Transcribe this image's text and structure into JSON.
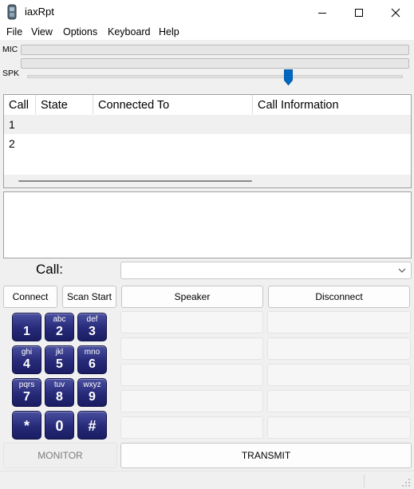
{
  "window": {
    "title": "iaxRpt",
    "controls": {
      "minimize": "minimize",
      "maximize": "maximize",
      "close": "close"
    }
  },
  "menu": [
    "File",
    "View",
    "Options",
    "Keyboard",
    "Help"
  ],
  "audio": {
    "mic_label": "MIC",
    "spk_label": "SPK",
    "mic_level": 0,
    "spk_level": 0,
    "spk_volume": 0.7
  },
  "calls_table": {
    "columns": [
      "Call",
      "State",
      "Connected To",
      "Call Information"
    ],
    "rows": [
      {
        "call": "1",
        "state": "",
        "connected_to": "",
        "info": ""
      },
      {
        "call": "2",
        "state": "",
        "connected_to": "",
        "info": ""
      }
    ]
  },
  "call": {
    "label": "Call:",
    "value": ""
  },
  "buttons": {
    "connect": "Connect",
    "scan_start": "Scan Start",
    "speaker": "Speaker",
    "disconnect": "Disconnect",
    "monitor": "MONITOR",
    "transmit": "TRANSMIT"
  },
  "keypad": [
    {
      "main": "1",
      "sub": ""
    },
    {
      "main": "2",
      "sub": "abc"
    },
    {
      "main": "3",
      "sub": "def"
    },
    {
      "main": "4",
      "sub": "ghi"
    },
    {
      "main": "5",
      "sub": "jkl"
    },
    {
      "main": "6",
      "sub": "mno"
    },
    {
      "main": "7",
      "sub": "pqrs"
    },
    {
      "main": "8",
      "sub": "tuv"
    },
    {
      "main": "9",
      "sub": "wxyz"
    },
    {
      "main": "*",
      "sub": ""
    },
    {
      "main": "0",
      "sub": ""
    },
    {
      "main": "#",
      "sub": ""
    }
  ]
}
